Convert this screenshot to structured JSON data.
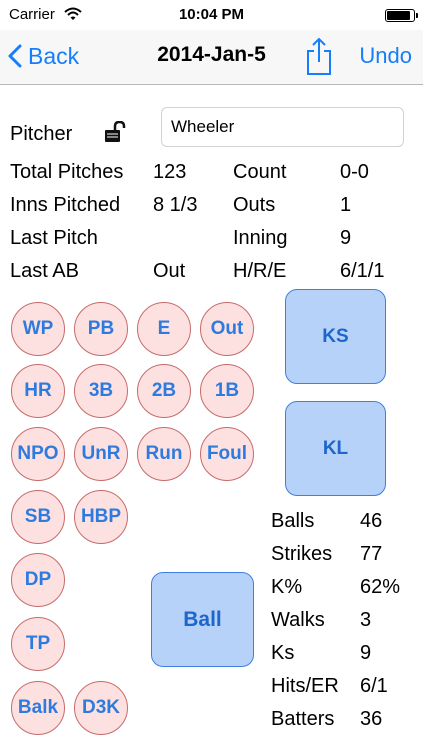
{
  "status_bar": {
    "carrier": "Carrier",
    "time": "10:04 PM"
  },
  "nav": {
    "back_label": "Back",
    "title": "2014-Jan-5",
    "undo_label": "Undo",
    "share_icon": "share-icon",
    "accent_color": "#157efb"
  },
  "pitcher": {
    "label": "Pitcher",
    "name": "Wheeler",
    "lock_icon": "unlocked-padlock-icon"
  },
  "stats_left": [
    {
      "label": "Total Pitches",
      "value": "123"
    },
    {
      "label": "Inns Pitched",
      "value": "8 1/3"
    },
    {
      "label": "Last Pitch",
      "value": ""
    },
    {
      "label": "Last AB",
      "value": "Out"
    }
  ],
  "stats_right": [
    {
      "label": "Count",
      "value": "0-0"
    },
    {
      "label": "Outs",
      "value": "1"
    },
    {
      "label": "Inning",
      "value": "9"
    },
    {
      "label": "H/R/E",
      "value": "6/1/1"
    }
  ],
  "event_buttons": [
    "WP",
    "PB",
    "E",
    "Out",
    "HR",
    "3B",
    "2B",
    "1B",
    "NPO",
    "UnR",
    "Run",
    "Foul",
    "SB",
    "HBP",
    "DP",
    "TP",
    "Balk",
    "D3K"
  ],
  "pitch_buttons": {
    "ks": "KS",
    "kl": "KL",
    "ball": "Ball"
  },
  "summary": [
    {
      "label": "Balls",
      "value": "46"
    },
    {
      "label": "Strikes",
      "value": "77"
    },
    {
      "label": "K%",
      "value": "62%"
    },
    {
      "label": "Walks",
      "value": "3"
    },
    {
      "label": "Ks",
      "value": "9"
    },
    {
      "label": "Hits/ER",
      "value": "6/1"
    },
    {
      "label": "Batters",
      "value": "36"
    }
  ],
  "colors": {
    "event_fill": "#fde0e0",
    "event_border": "#c76b6b",
    "event_text": "#2e7be0",
    "pitch_fill": "#b6d2f8",
    "pitch_border": "#3f7fdf"
  }
}
